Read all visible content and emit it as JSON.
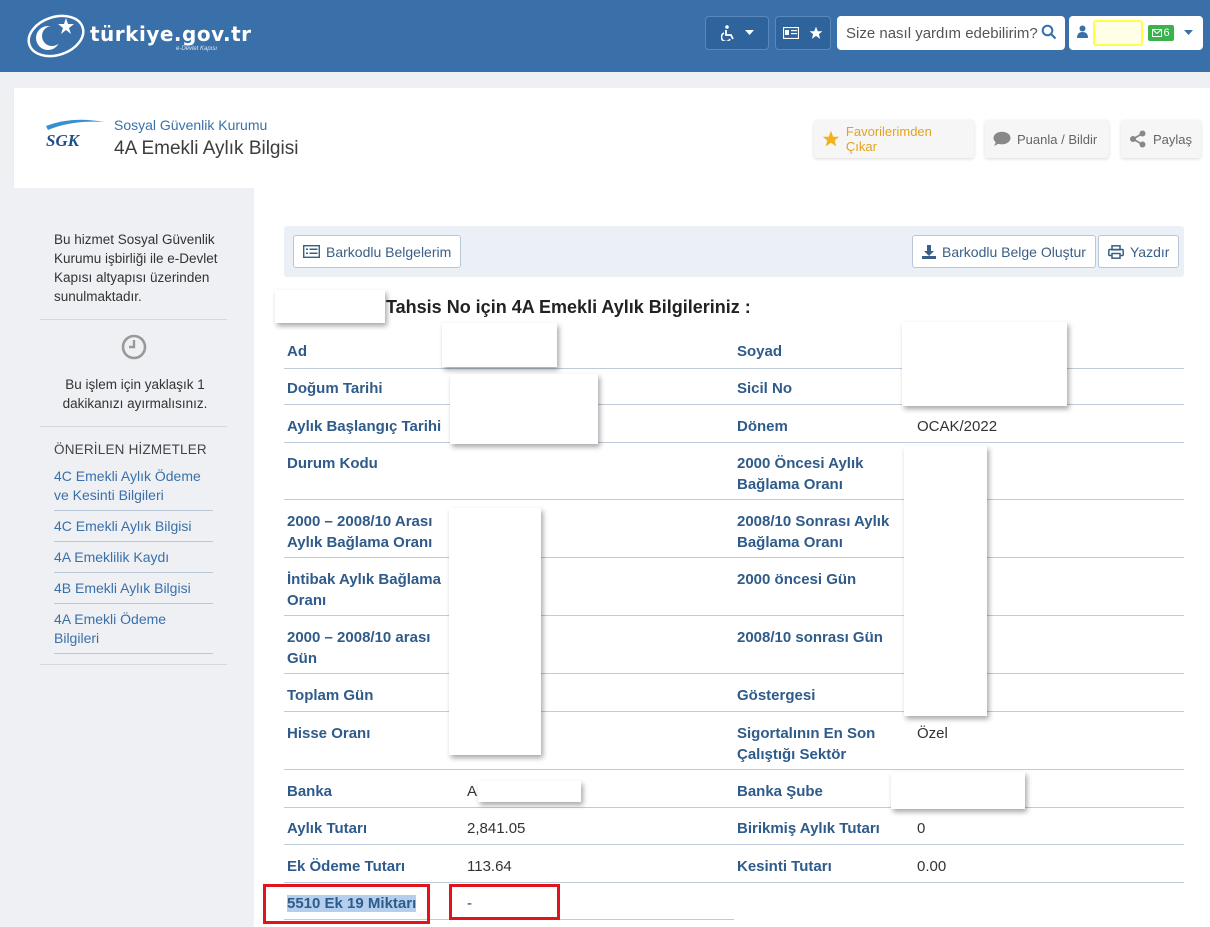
{
  "topbar": {
    "logo_text": "türkiye.gov.tr",
    "logo_sub": "e-Devlet Kapısı",
    "search_placeholder": "Size nasıl yardım edebilirim?",
    "message_count": "6"
  },
  "header": {
    "institution": "Sosyal Güvenlik Kurumu",
    "service_title": "4A Emekli Aylık Bilgisi",
    "logo_text": "SGK",
    "buttons": {
      "favorite": "Favorilerimden Çıkar",
      "rate": "Puanla / Bildir",
      "share": "Paylaş"
    }
  },
  "sidebar": {
    "info": "Bu hizmet Sosyal Güvenlik Kurumu işbirliği ile e-Devlet Kapısı altyapısı üzerinden sunulmaktadır.",
    "time_note": "Bu işlem için yaklaşık 1 dakikanızı ayırmalısınız.",
    "recommended_title": "ÖNERİLEN HİZMETLER",
    "links": [
      "4C Emekli Aylık Ödeme ve Kesinti Bilgileri",
      "4C Emekli Aylık Bilgisi",
      "4A Emeklilik Kaydı",
      "4B Emekli Aylık Bilgisi",
      "4A Emekli Ödeme Bilgileri"
    ]
  },
  "toolbar": {
    "barcodes": "Barkodlu Belgelerim",
    "create": "Barkodlu Belge Oluştur",
    "print": "Yazdır"
  },
  "content": {
    "section_title": "Tahsis No için 4A Emekli Aylık Bilgileriniz :",
    "left": [
      {
        "label": "Ad",
        "value": ""
      },
      {
        "label": "Doğum Tarihi",
        "value": ""
      },
      {
        "label": "Aylık Başlangıç Tarihi",
        "value": ""
      },
      {
        "label": "Durum Kodu",
        "value": ""
      },
      {
        "label": "2000 – 2008/10 Arası Aylık Bağlama Oranı",
        "value": ""
      },
      {
        "label": "İntibak Aylık Bağlama Oranı",
        "value": ""
      },
      {
        "label": "2000 – 2008/10 arası Gün",
        "value": ""
      },
      {
        "label": "Toplam Gün",
        "value": ""
      },
      {
        "label": "Hisse Oranı",
        "value": ""
      },
      {
        "label": "Banka",
        "value": "A"
      },
      {
        "label": "Aylık Tutarı",
        "value": "2,841.05"
      },
      {
        "label": "Ek Ödeme Tutarı",
        "value": "113.64"
      },
      {
        "label": "5510 Ek 19 Miktarı",
        "value": "-"
      }
    ],
    "right": [
      {
        "label": "Soyad",
        "value": ""
      },
      {
        "label": "Sicil No",
        "value": ""
      },
      {
        "label": "Dönem",
        "value": "OCAK/2022"
      },
      {
        "label": "2000 Öncesi Aylık Bağlama Oranı",
        "value": ""
      },
      {
        "label": "2008/10 Sonrası Aylık Bağlama Oranı",
        "value": ""
      },
      {
        "label": "2000 öncesi Gün",
        "value": ""
      },
      {
        "label": "2008/10 sonrası Gün",
        "value": ""
      },
      {
        "label": "Göstergesi",
        "value": ""
      },
      {
        "label": "Sigortalının En Son Çalıştığı Sektör",
        "value": "Özel"
      },
      {
        "label": "Banka Şube",
        "value": ""
      },
      {
        "label": "Birikmiş Aylık Tutarı",
        "value": "0"
      },
      {
        "label": "Kesinti Tutarı",
        "value": "0.00"
      }
    ]
  },
  "colors": {
    "topbar": "#3a70aa",
    "label": "#2f5b8a",
    "favorite": "#e4a21c",
    "highlight": "#e0141c"
  }
}
